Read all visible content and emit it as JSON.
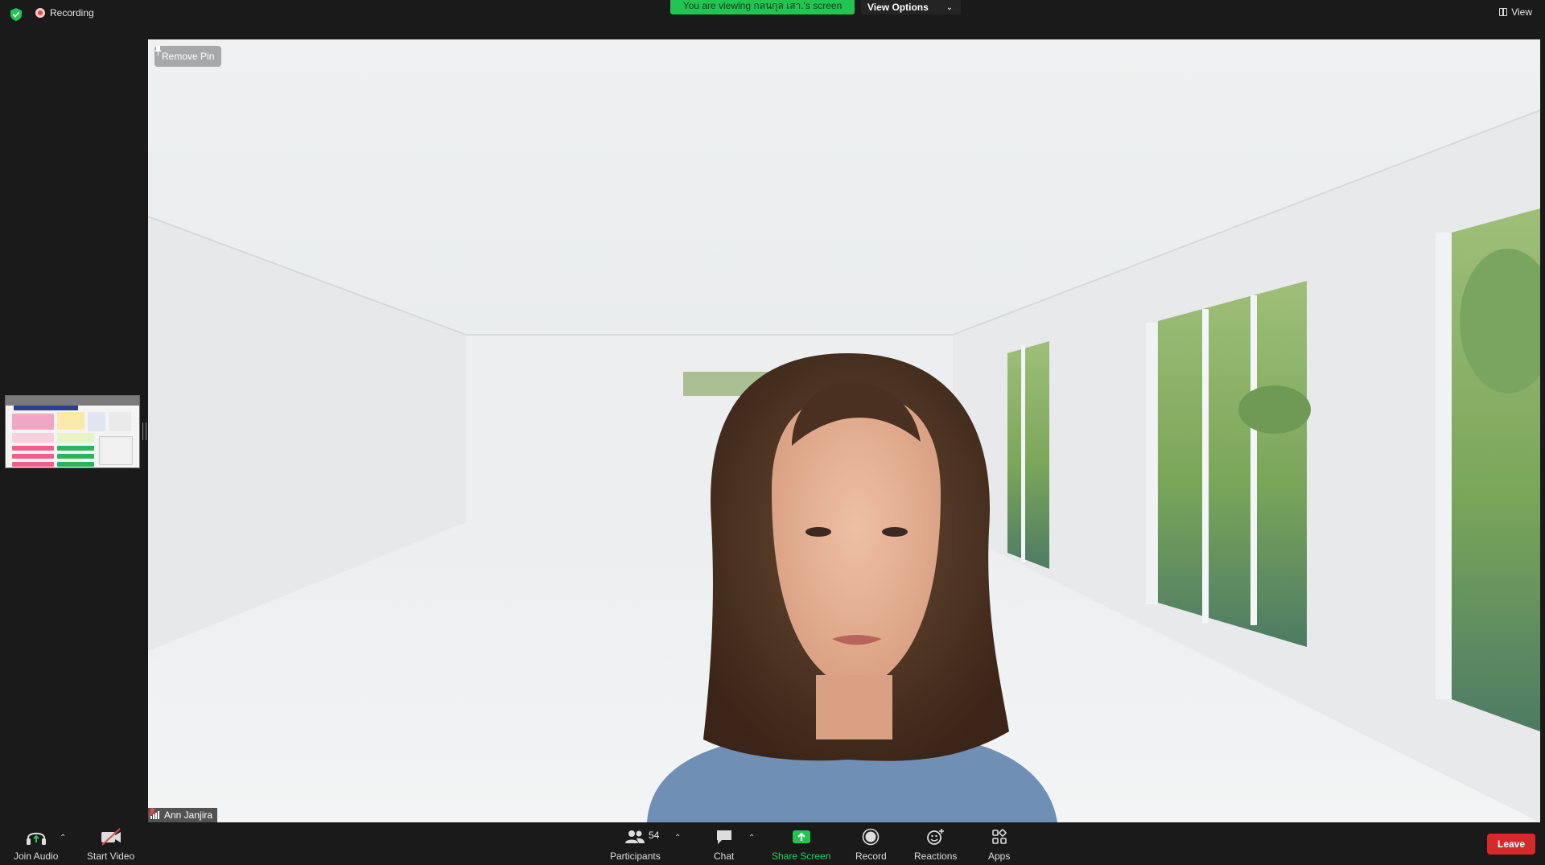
{
  "top_bar": {
    "recording_label": "Recording",
    "viewing_banner": "You are viewing กลนกุล เสา.'s screen",
    "view_options_label": "View Options",
    "view_label": "View"
  },
  "video": {
    "remove_pin_label": "Remove Pin",
    "participant_name": "Ann Janjira"
  },
  "toolbar": {
    "join_audio_label": "Join Audio",
    "start_video_label": "Start Video",
    "participants_label": "Participants",
    "participants_count": "54",
    "chat_label": "Chat",
    "share_screen_label": "Share Screen",
    "record_label": "Record",
    "reactions_label": "Reactions",
    "apps_label": "Apps",
    "leave_label": "Leave"
  },
  "colors": {
    "share_green": "#23c552",
    "leave_red": "#d52a2a",
    "recording_red": "#e04b4b"
  },
  "icons": [
    "shield-icon",
    "recording-icon",
    "view-grid-icon",
    "pin-icon",
    "signal-icon",
    "muted-mic-icon",
    "headphones-icon",
    "video-off-icon",
    "participants-icon",
    "chat-icon",
    "share-screen-icon",
    "record-icon",
    "reactions-icon",
    "apps-icon"
  ]
}
